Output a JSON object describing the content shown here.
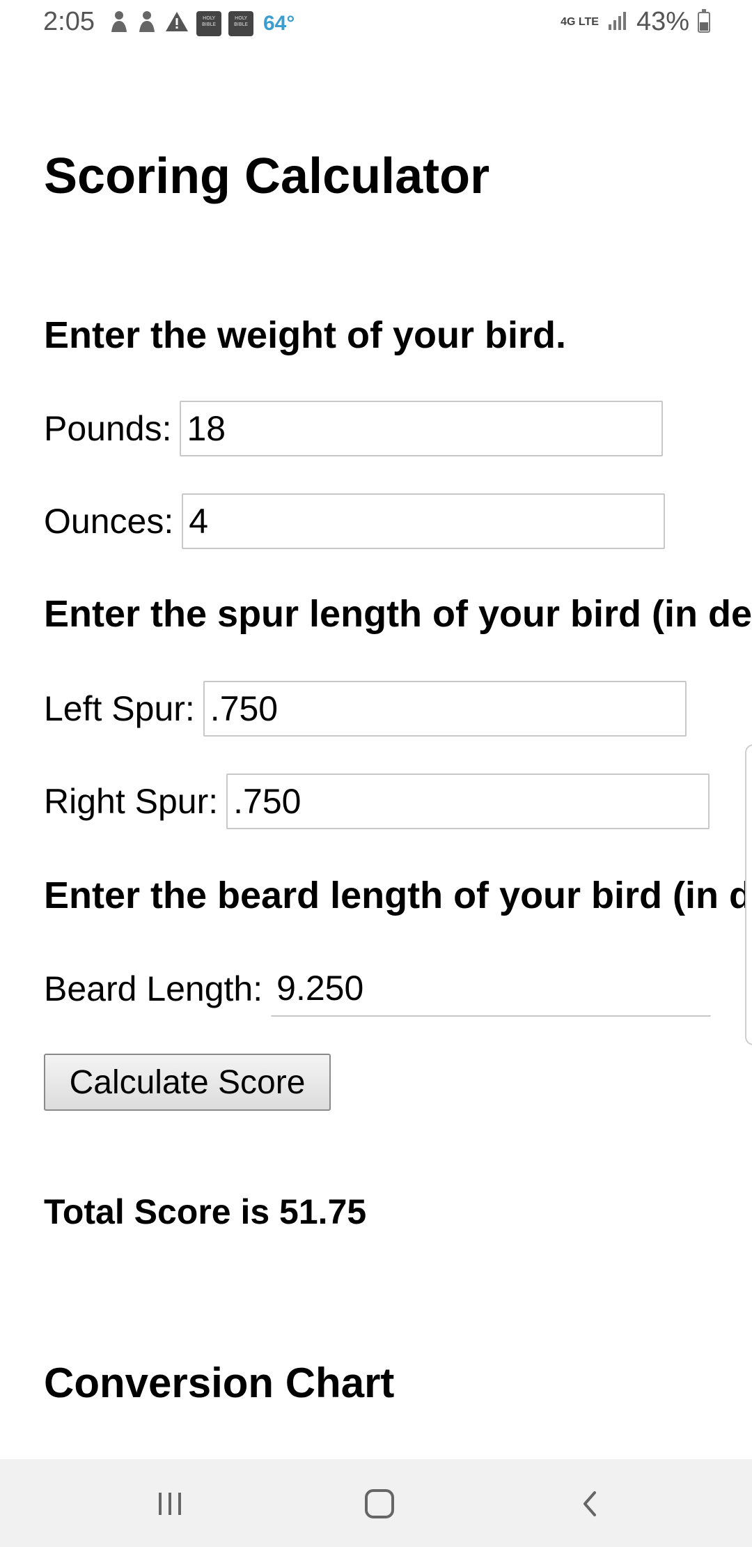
{
  "status_bar": {
    "time": "2:05",
    "left_icons": [
      "person-icon",
      "person-icon",
      "warning-icon",
      "holy-bible-icon",
      "holy-bible-icon"
    ],
    "bible_icon_text": "HOLY BIBLE",
    "temperature": "64°",
    "network": "4G LTE",
    "battery": "43%"
  },
  "page": {
    "title": "Scoring Calculator",
    "weight_heading": "Enter the weight of your bird.",
    "pounds": {
      "label": "Pounds:",
      "value": "18"
    },
    "ounces": {
      "label": "Ounces:",
      "value": "4"
    },
    "spur_heading": "Enter the spur length of your bird (in de",
    "left_spur": {
      "label": "Left Spur:",
      "value": ".750"
    },
    "right_spur": {
      "label": "Right Spur:",
      "value": ".750"
    },
    "beard_heading": "Enter the beard length of your bird (in d",
    "beard": {
      "label": "Beard Length:",
      "value": "9.250"
    },
    "calculate_button": "Calculate Score",
    "result": "Total Score is 51.75",
    "chart_heading": "Conversion Chart"
  },
  "colors": {
    "temperature": "#3a9fd0",
    "input_border": "#c8c8c8",
    "nav_bar_bg": "#f1f1f1"
  }
}
